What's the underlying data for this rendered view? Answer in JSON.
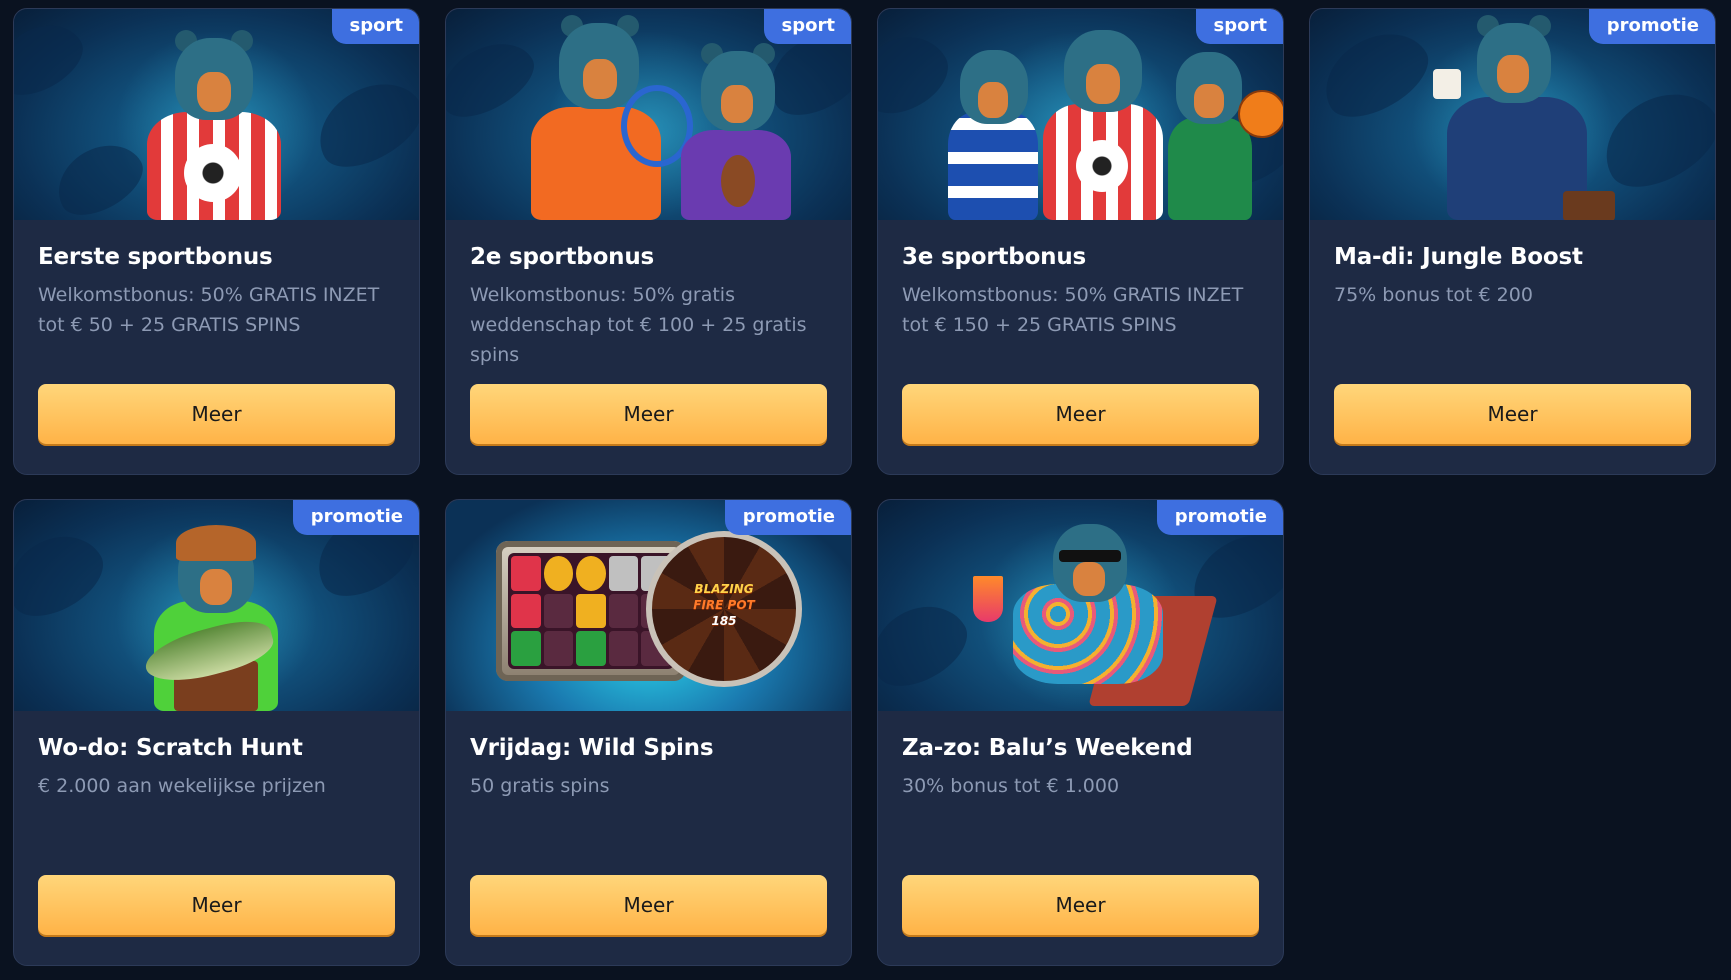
{
  "cards": [
    {
      "badge": "sport",
      "title": "Eerste sportbonus",
      "description": "Welkomstbonus: 50% GRATIS INZET tot € 50 + 25 GRATIS SPINS",
      "button": "Meer",
      "illustration": "bear-soccer-player"
    },
    {
      "badge": "sport",
      "title": "2e sportbonus",
      "description": "Welkomstbonus: 50% gratis weddenschap tot € 100 + 25 gratis spins",
      "button": "Meer",
      "illustration": "bears-tennis-football"
    },
    {
      "badge": "sport",
      "title": "3e sportbonus",
      "description": "Welkomstbonus: 50% GRATIS INZET tot € 150 + 25 GRATIS SPINS",
      "button": "Meer",
      "illustration": "bears-hockey-soccer-basketball"
    },
    {
      "badge": "promotie",
      "title": "Ma-di: Jungle Boost",
      "description": "75% bonus tot € 200",
      "button": "Meer",
      "illustration": "bear-businessman"
    },
    {
      "badge": "promotie",
      "title": "Wo-do: Scratch Hunt",
      "description": "€ 2.000 aan wekelijkse prijzen",
      "button": "Meer",
      "illustration": "bear-fisherman"
    },
    {
      "badge": "promotie",
      "title": "Vrijdag: Wild Spins",
      "description": "50 gratis spins",
      "button": "Meer",
      "illustration": "slot-machine-wheel",
      "wheel_text": [
        "BLAZING",
        "FIRE POT",
        "185"
      ]
    },
    {
      "badge": "promotie",
      "title": "Za-zo: Balu’s Weekend",
      "description": "30% bonus tot € 1.000",
      "button": "Meer",
      "illustration": "bear-beach-chair"
    }
  ],
  "colors": {
    "page_bg": "#0a1220",
    "card_bg": "#1e2a44",
    "badge_bg": "#3e6fe0",
    "button_top": "#ffd67a",
    "button_bottom": "#ffb347",
    "muted_text": "#8d9ab4"
  }
}
